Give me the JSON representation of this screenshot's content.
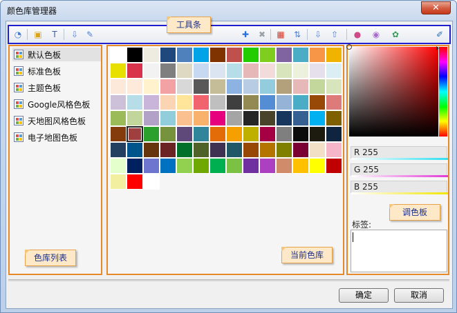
{
  "window": {
    "title": "颜色库管理器",
    "close_glyph": "✕"
  },
  "callouts": {
    "toolbar": "工具条",
    "library_list": "色库列表",
    "current_library": "当前色库",
    "palette": "调色板"
  },
  "toolbar": {
    "left_buttons": [
      {
        "name": "palette-settings-icon",
        "glyph": "◔",
        "color": "#4a7bd0"
      },
      {
        "name": "import-image-icon",
        "glyph": "▣",
        "color": "#d9a21b"
      },
      {
        "name": "text-format-icon",
        "glyph": "T",
        "color": "#3a5fa8"
      },
      {
        "name": "export-library-icon",
        "glyph": "⇩",
        "color": "#4f7fd0"
      },
      {
        "name": "edit-library-icon",
        "glyph": "✎",
        "color": "#4f7fd0"
      }
    ],
    "right_buttons": [
      {
        "name": "add-color-icon",
        "glyph": "✚",
        "color": "#2a6fd6"
      },
      {
        "name": "delete-color-icon",
        "glyph": "✖",
        "color": "#9aa0a8"
      },
      {
        "name": "clear-grid-icon",
        "glyph": "▦",
        "color": "#d23a2a"
      },
      {
        "name": "sort-colors-icon",
        "glyph": "⇅",
        "color": "#4f7fd0"
      },
      {
        "name": "import-colors-icon",
        "glyph": "⇩",
        "color": "#4f7fd0"
      },
      {
        "name": "export-colors-icon",
        "glyph": "⇧",
        "color": "#4f7fd0"
      },
      {
        "name": "color-wheel-icon",
        "glyph": "●",
        "color": "#d04a8a"
      },
      {
        "name": "color-ring-icon",
        "glyph": "◉",
        "color": "#a96ad0"
      },
      {
        "name": "color-picker-group-icon",
        "glyph": "✿",
        "color": "#3b9a5a"
      },
      {
        "name": "eyedropper-icon",
        "glyph": "✐",
        "color": "#2f6fb0"
      }
    ]
  },
  "libraries": [
    {
      "label": "默认色板",
      "selected": true
    },
    {
      "label": "标准色板",
      "selected": false
    },
    {
      "label": "主题色板",
      "selected": false
    },
    {
      "label": "Google风格色板",
      "selected": false
    },
    {
      "label": "天地图风格色板",
      "selected": false
    },
    {
      "label": "电子地图色板",
      "selected": false
    }
  ],
  "swatches": [
    "#ffffff",
    "#000000",
    "#eeece1",
    "#1f497d",
    "#4f81bd",
    "#00a2e8",
    "#7f3300",
    "#c0504d",
    "#22cc00",
    "#7fce1f",
    "#8064a2",
    "#4bacc6",
    "#f79646",
    "#f0b400",
    "#e8e000",
    "#d8334a",
    "#f2f2f2",
    "#7f7f7f",
    "#ddd9c3",
    "#c6d9f0",
    "#dbe5f1",
    "#b7dde8",
    "#e6b9b8",
    "#f2dcdb",
    "#d7e4bc",
    "#ebf1dd",
    "#e5e0ec",
    "#dbeef3",
    "#fde9d9",
    "#fdeada",
    "#fff2cc",
    "#f2a2a2",
    "#d8d8d8",
    "#595959",
    "#c4bd97",
    "#8db3e2",
    "#b8cce4",
    "#93cddd",
    "#b2a17a",
    "#e6b8b7",
    "#c3d69b",
    "#d8e4bc",
    "#ccc1d9",
    "#b6dde8",
    "#c9b5d9",
    "#fbd4b4",
    "#ffe599",
    "#f1646e",
    "#bfbfbf",
    "#3f3f3f",
    "#938953",
    "#548dd4",
    "#95b3d7",
    "#4bacc6",
    "#984807",
    "#dc7b7a",
    "#9bbb59",
    "#c2d69b",
    "#b2a2c7",
    "#92cddc",
    "#fac08f",
    "#f9b26b",
    "#e6007e",
    "#a5a5a5",
    "#262626",
    "#494429",
    "#17365d",
    "#366092",
    "#00b0f0",
    "#7f6000",
    "#843c0c",
    "#9f3f3f",
    "#2ca02c",
    "#76923c",
    "#5f497a",
    "#31859b",
    "#e36c09",
    "#f59f00",
    "#bfb000",
    "#a50044",
    "#7f7f7f",
    "#0c0c0c",
    "#1d1b10",
    "#0f243e",
    "#244061",
    "#00548c",
    "#66350d",
    "#6b2324",
    "#00702a",
    "#4f6228",
    "#3f3151",
    "#205867",
    "#974806",
    "#b37400",
    "#7f7f00",
    "#7a0033",
    "#f2e0c6",
    "#f4b6c8",
    "#e5ffcc",
    "#002060",
    "#6d75cf",
    "#0070c0",
    "#92d050",
    "#6ea800",
    "#00b050",
    "#7bc143",
    "#7030a0",
    "#ad40c0",
    "#d08b6b",
    "#ffc000",
    "#ffff00",
    "#c00000",
    "#f2f0a0",
    "#ff0000",
    "#ffffff"
  ],
  "selected_swatch_index": 71,
  "palette": {
    "r_label": "R 255",
    "g_label": "G 255",
    "b_label": "B 255",
    "tag_label": "标签:",
    "tag_value": ""
  },
  "buttons": {
    "ok": "确定",
    "cancel": "取消"
  }
}
